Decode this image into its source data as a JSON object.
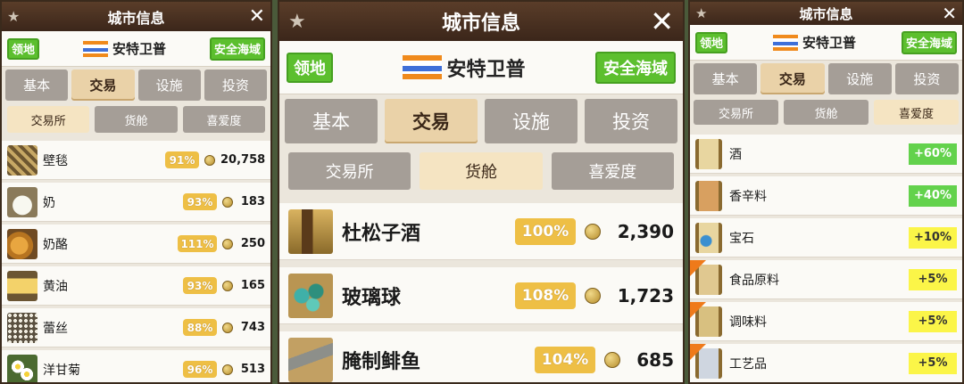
{
  "panels": [
    {
      "title": "城市信息",
      "close_glyph": "✕",
      "star_glyph": "★",
      "territory_badge": "领地",
      "city_name": "安特卫普",
      "safety_badge": "安全海域",
      "tabs": [
        "基本",
        "交易",
        "设施",
        "投资"
      ],
      "selected_tab": 1,
      "subtabs": [
        "交易所",
        "货舱",
        "喜爱度"
      ],
      "selected_subtab": 0,
      "items": [
        {
          "name": "壁毯",
          "pct": "91%",
          "price": "20,758",
          "icon": "tapestry-icon"
        },
        {
          "name": "奶",
          "pct": "93%",
          "price": "183",
          "icon": "milk-icon"
        },
        {
          "name": "奶酪",
          "pct": "111%",
          "price": "250",
          "icon": "cheese-icon"
        },
        {
          "name": "黄油",
          "pct": "93%",
          "price": "165",
          "icon": "butter-icon"
        },
        {
          "name": "蕾丝",
          "pct": "88%",
          "price": "743",
          "icon": "lace-icon"
        },
        {
          "name": "洋甘菊",
          "pct": "96%",
          "price": "513",
          "icon": "chamomile-icon"
        }
      ]
    },
    {
      "title": "城市信息",
      "close_glyph": "✕",
      "star_glyph": "★",
      "territory_badge": "领地",
      "city_name": "安特卫普",
      "safety_badge": "安全海域",
      "tabs": [
        "基本",
        "交易",
        "设施",
        "投资"
      ],
      "selected_tab": 1,
      "subtabs": [
        "交易所",
        "货舱",
        "喜爱度"
      ],
      "selected_subtab": 1,
      "items": [
        {
          "name": "杜松子酒",
          "pct": "100%",
          "price": "2,390",
          "icon": "gin-bottle-icon"
        },
        {
          "name": "玻璃球",
          "pct": "108%",
          "price": "1,723",
          "icon": "glass-ball-icon"
        },
        {
          "name": "腌制鲱鱼",
          "pct": "104%",
          "price": "685",
          "icon": "herring-icon"
        }
      ]
    },
    {
      "title": "城市信息",
      "close_glyph": "✕",
      "star_glyph": "★",
      "territory_badge": "领地",
      "city_name": "安特卫普",
      "safety_badge": "安全海域",
      "tabs": [
        "基本",
        "交易",
        "设施",
        "投资"
      ],
      "selected_tab": 1,
      "subtabs": [
        "交易所",
        "货舱",
        "喜爱度"
      ],
      "selected_subtab": 2,
      "items": [
        {
          "name": "酒",
          "pref": "+60%",
          "level": "green",
          "icon": "scroll-wine-icon",
          "new": false
        },
        {
          "name": "香辛料",
          "pref": "+40%",
          "level": "green",
          "icon": "scroll-spice-icon",
          "new": false
        },
        {
          "name": "宝石",
          "pref": "+10%",
          "level": "yellow",
          "icon": "scroll-gem-icon",
          "new": false
        },
        {
          "name": "食品原料",
          "pref": "+5%",
          "level": "yellow",
          "icon": "scroll-food-icon",
          "new": true
        },
        {
          "name": "调味料",
          "pref": "+5%",
          "level": "yellow",
          "icon": "scroll-seasoning-icon",
          "new": true
        },
        {
          "name": "工艺品",
          "pref": "+5%",
          "level": "yellow",
          "icon": "scroll-craft-icon",
          "new": true
        }
      ]
    }
  ],
  "colors": {
    "title_bg": "#4a3020",
    "badge_green": "#5cbf2e",
    "tab_grey": "#a59e97",
    "tab_selected": "#ead2a8",
    "pct_gold": "#eebf45",
    "pref_green": "#63d24c",
    "pref_yellow": "#fbf548"
  }
}
